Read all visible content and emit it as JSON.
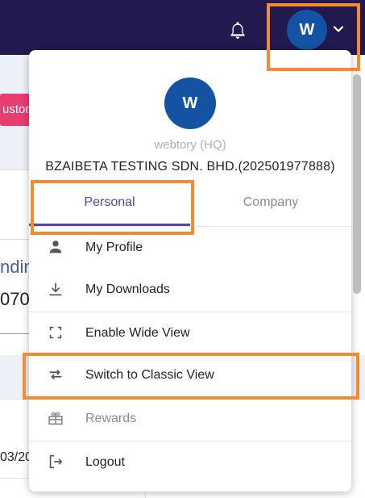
{
  "header": {
    "avatar_initial": "W"
  },
  "background": {
    "button_fragment": "ustom",
    "heading_fragment": "ndin",
    "number_fragment": "070",
    "date_fragment": "03/20"
  },
  "menu": {
    "avatar_initial": "W",
    "subtitle": "webtory (HQ)",
    "company_name": "BZAIBETA TESTING SDN. BHD.(202501977888)",
    "tabs": [
      {
        "label": "Personal",
        "active": true
      },
      {
        "label": "Company",
        "active": false
      }
    ],
    "items": [
      {
        "label": "My Profile",
        "icon": "person-icon"
      },
      {
        "label": "My Downloads",
        "icon": "download-icon"
      },
      {
        "label": "Enable Wide View",
        "icon": "expand-icon"
      },
      {
        "label": "Switch to Classic View",
        "icon": "swap-icon"
      },
      {
        "label": "Rewards",
        "icon": "gift-icon",
        "muted": true
      },
      {
        "label": "Logout",
        "icon": "logout-icon"
      }
    ]
  },
  "colors": {
    "topbar": "#221a4f",
    "avatar": "#1453a3",
    "accent": "#5b4499",
    "highlight": "#f58a30"
  }
}
